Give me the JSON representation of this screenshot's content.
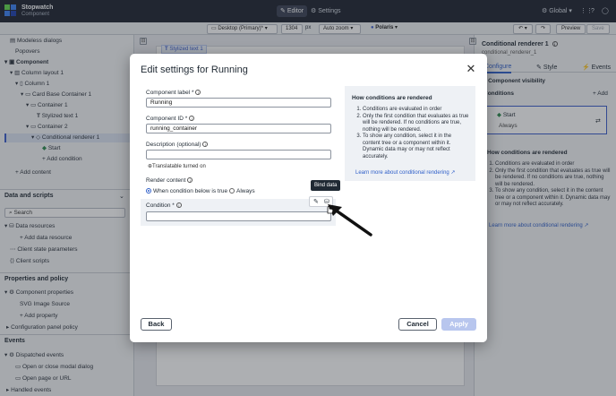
{
  "topbar": {
    "app_title": "Stopwatch",
    "app_subtitle": "Component",
    "tab_editor": "Editor",
    "tab_settings": "Settings",
    "global_label": "Global",
    "grid_icon": "grid-icon",
    "help_icon": "help-icon",
    "profile_icon": "profile-icon"
  },
  "toolbar": {
    "viewport": "Desktop (Primary)*",
    "width_value": "1304",
    "width_unit": "px",
    "zoom": "Auto zoom",
    "theme": "Polaris",
    "preview": "Preview",
    "save": "Save"
  },
  "sidebar": {
    "tree": [
      {
        "label": "Modeless dialogs",
        "indent": 1
      },
      {
        "label": "Popovers",
        "indent": 1
      },
      {
        "label": "Component",
        "indent": 0
      },
      {
        "label": "Column layout 1",
        "indent": 1
      },
      {
        "label": "Column 1",
        "indent": 2
      },
      {
        "label": "Card Base Container 1",
        "indent": 3
      },
      {
        "label": "Container 1",
        "indent": 4
      },
      {
        "label": "Stylized text 1",
        "indent": 5
      },
      {
        "label": "Container 2",
        "indent": 4
      },
      {
        "label": "Conditional renderer 1",
        "indent": 5
      },
      {
        "label": "Start",
        "indent": 6
      },
      {
        "label": "+ Add condition",
        "indent": 6
      }
    ],
    "add_content": "+ Add content",
    "data_scripts_header": "Data and scripts",
    "search_placeholder": "Search",
    "data_resources": "Data resources",
    "add_data_resource": "+ Add data resource",
    "client_state": "Client state parameters",
    "client_scripts": "Client scripts",
    "props_header": "Properties and policy",
    "component_props": "Component properties",
    "svg_image_source": "SVG Image Source",
    "add_property": "+ Add property",
    "config_policy": "Configuration panel policy",
    "events_header": "Events",
    "dispatched_events": "Dispatched events",
    "open_close_modal": "Open or close modal dialog",
    "open_page_url": "Open page or URL",
    "handled_events": "Handled events"
  },
  "canvas": {
    "tag": "Stylized text 1"
  },
  "right_panel": {
    "title": "Conditional renderer 1",
    "subtitle": "conditional_renderer_1",
    "tab_configure": "Configure",
    "tab_style": "Style",
    "tab_events": "Events",
    "component_visibility": "Component visibility",
    "conditions_label": "Conditions",
    "add_label": "+ Add",
    "condition_name": "Start",
    "condition_value": "Always",
    "help_title": "How conditions are rendered",
    "help_items": [
      "Conditions are evaluated in order",
      "Only the first condition that evaluates as true will be rendered. If no conditions are true, nothing will be rendered.",
      "To show any condition, select it in the content tree or a component within it. Dynamic data may or may not reflect accurately."
    ],
    "help_link": "Learn more about conditional rendering"
  },
  "modal": {
    "title": "Edit settings for Running",
    "component_label_label": "Component label *",
    "component_label_value": "Running",
    "component_id_label": "Component ID *",
    "component_id_value": "running_container",
    "description_label": "Description (optional)",
    "description_value": "",
    "translatable_note": "Translatable turned on",
    "render_content_label": "Render content",
    "radio_when": "When condition below is true",
    "radio_always": "Always",
    "condition_label": "Condition *",
    "condition_value": "",
    "tooltip": "Bind data",
    "help_title": "How conditions are rendered",
    "help_items": [
      "Conditions are evaluated in order",
      "Only the first condition that evaluates as true will be rendered. If no conditions are true, nothing will be rendered.",
      "To show any condition, select it in the content tree or a component within it. Dynamic data may or may not reflect accurately."
    ],
    "help_link": "Learn more about conditional rendering",
    "back": "Back",
    "cancel": "Cancel",
    "apply": "Apply"
  },
  "colors": {
    "accent": "#2f5fc9",
    "topbar": "#1d2330",
    "apply_disabled": "#b8c6ee"
  }
}
